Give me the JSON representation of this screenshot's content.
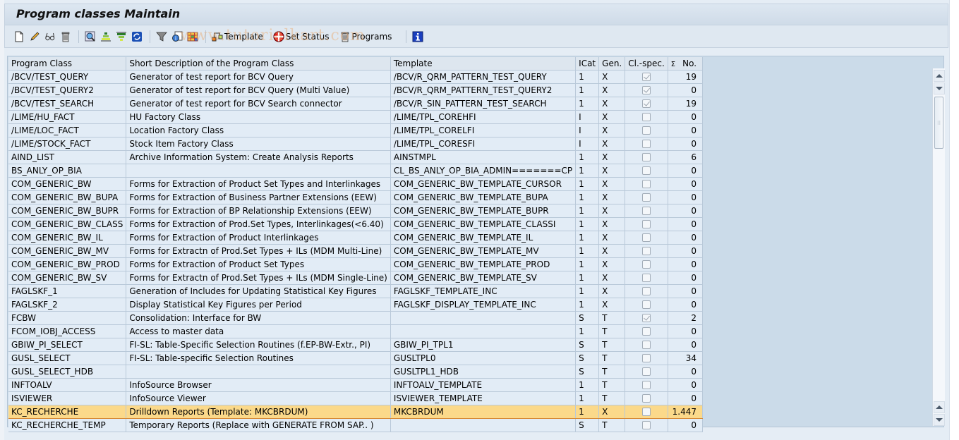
{
  "window": {
    "title": "Program classes Maintain"
  },
  "watermark": "www.tutorialkart.com",
  "toolbar": {
    "items": [
      {
        "icon": "new-document-icon"
      },
      {
        "icon": "pencil-edit-icon"
      },
      {
        "icon": "glasses-display-icon"
      },
      {
        "icon": "trash-delete-icon"
      },
      {
        "icon": "find-icon"
      },
      {
        "icon": "sort-ascending-icon"
      },
      {
        "icon": "sort-descending-icon"
      },
      {
        "icon": "refresh-icon"
      },
      {
        "icon": "filter-icon"
      },
      {
        "icon": "details-icon"
      },
      {
        "icon": "layout-grid-icon"
      }
    ],
    "template_label": "Template",
    "set_status_label": "Set Status",
    "programs_label": "Programs",
    "info_icon": "info-icon"
  },
  "table": {
    "columns": [
      "Program Class",
      "Short Description of the Program Class",
      "Template",
      "ICat",
      "Gen.",
      "Cl.-spec.",
      "No."
    ],
    "sum_symbol": "Σ",
    "selected_row": 25,
    "rows": [
      {
        "program_class": "/BCV/TEST_QUERY",
        "description": "Generator of test report for BCV Query",
        "template": "/BCV/R_QRM_PATTERN_TEST_QUERY",
        "icat": "1",
        "gen": "X",
        "cl_spec": true,
        "no": "19"
      },
      {
        "program_class": "/BCV/TEST_QUERY2",
        "description": "Generator of test report for BCV Query (Multi Value)",
        "template": "/BCV/R_QRM_PATTERN_TEST_QUERY2",
        "icat": "1",
        "gen": "X",
        "cl_spec": true,
        "no": "0"
      },
      {
        "program_class": "/BCV/TEST_SEARCH",
        "description": "Generator of test report for BCV Search connector",
        "template": "/BCV/R_SIN_PATTERN_TEST_SEARCH",
        "icat": "1",
        "gen": "X",
        "cl_spec": true,
        "no": "19"
      },
      {
        "program_class": "/LIME/HU_FACT",
        "description": "HU Factory Class",
        "template": "/LIME/TPL_COREHFI",
        "icat": "I",
        "gen": "X",
        "cl_spec": false,
        "no": "0"
      },
      {
        "program_class": "/LIME/LOC_FACT",
        "description": "Location Factory Class",
        "template": "/LIME/TPL_CORELFI",
        "icat": "I",
        "gen": "X",
        "cl_spec": false,
        "no": "0"
      },
      {
        "program_class": "/LIME/STOCK_FACT",
        "description": "Stock Item Factory Class",
        "template": "/LIME/TPL_CORESFI",
        "icat": "I",
        "gen": "X",
        "cl_spec": false,
        "no": "0"
      },
      {
        "program_class": "AIND_LIST",
        "description": "Archive Information System: Create Analysis Reports",
        "template": "AINSTMPL",
        "icat": "1",
        "gen": "X",
        "cl_spec": false,
        "no": "6"
      },
      {
        "program_class": "BS_ANLY_OP_BIA",
        "description": "",
        "template": "CL_BS_ANLY_OP_BIA_ADMIN=======CP",
        "icat": "1",
        "gen": "X",
        "cl_spec": false,
        "no": "0"
      },
      {
        "program_class": "COM_GENERIC_BW",
        "description": "Forms for Extraction of Product Set Types and Interlinkages",
        "template": "COM_GENERIC_BW_TEMPLATE_CURSOR",
        "icat": "1",
        "gen": "X",
        "cl_spec": false,
        "no": "0"
      },
      {
        "program_class": "COM_GENERIC_BW_BUPA",
        "description": "Forms for Extraction of Business Partner Extensions (EEW)",
        "template": "COM_GENERIC_BW_TEMPLATE_BUPA",
        "icat": "1",
        "gen": "X",
        "cl_spec": false,
        "no": "0"
      },
      {
        "program_class": "COM_GENERIC_BW_BUPR",
        "description": "Forms for Extraction of BP Relationship Extensions (EEW)",
        "template": "COM_GENERIC_BW_TEMPLATE_BUPR",
        "icat": "1",
        "gen": "X",
        "cl_spec": false,
        "no": "0"
      },
      {
        "program_class": "COM_GENERIC_BW_CLASS",
        "description": "Forms for Extraction of Prod.Set Types, Interlinkages(<6.40)",
        "template": "COM_GENERIC_BW_TEMPLATE_CLASSI",
        "icat": "1",
        "gen": "X",
        "cl_spec": false,
        "no": "0"
      },
      {
        "program_class": "COM_GENERIC_BW_IL",
        "description": "Forms for Extraction of Product Interlinkages",
        "template": "COM_GENERIC_BW_TEMPLATE_IL",
        "icat": "1",
        "gen": "X",
        "cl_spec": false,
        "no": "0"
      },
      {
        "program_class": "COM_GENERIC_BW_MV",
        "description": "Forms for Extractn of Prod.Set Types + ILs (MDM Multi-Line)",
        "template": "COM_GENERIC_BW_TEMPLATE_MV",
        "icat": "1",
        "gen": "X",
        "cl_spec": false,
        "no": "0"
      },
      {
        "program_class": "COM_GENERIC_BW_PROD",
        "description": "Forms for Extraction of Product Set Types",
        "template": "COM_GENERIC_BW_TEMPLATE_PROD",
        "icat": "1",
        "gen": "X",
        "cl_spec": false,
        "no": "0"
      },
      {
        "program_class": "COM_GENERIC_BW_SV",
        "description": "Forms for Extractn of Prod.Set Types + ILs (MDM Single-Line)",
        "template": "COM_GENERIC_BW_TEMPLATE_SV",
        "icat": "1",
        "gen": "X",
        "cl_spec": false,
        "no": "0"
      },
      {
        "program_class": "FAGLSKF_1",
        "description": "Generation of Includes for Updating Statistical Key Figures",
        "template": "FAGLSKF_TEMPLATE_INC",
        "icat": "1",
        "gen": "X",
        "cl_spec": false,
        "no": "0"
      },
      {
        "program_class": "FAGLSKF_2",
        "description": "Display Statistical Key Figures per Period",
        "template": "FAGLSKF_DISPLAY_TEMPLATE_INC",
        "icat": "1",
        "gen": "X",
        "cl_spec": false,
        "no": "0"
      },
      {
        "program_class": "FCBW",
        "description": "Consolidation: Interface for BW",
        "template": "",
        "icat": "S",
        "gen": "T",
        "cl_spec": true,
        "no": "2"
      },
      {
        "program_class": "FCOM_IOBJ_ACCESS",
        "description": "Access to master data",
        "template": "",
        "icat": "1",
        "gen": "T",
        "cl_spec": false,
        "no": "0"
      },
      {
        "program_class": "GBIW_PI_SELECT",
        "description": "FI-SL: Table-Specific Selection Routines (f.EP-BW-Extr., PI)",
        "template": "GBIW_PI_TPL1",
        "icat": "S",
        "gen": "T",
        "cl_spec": false,
        "no": "0"
      },
      {
        "program_class": "GUSL_SELECT",
        "description": "FI-SL: Table-specific Selection Routines",
        "template": "GUSLTPL0",
        "icat": "S",
        "gen": "T",
        "cl_spec": false,
        "no": "34"
      },
      {
        "program_class": "GUSL_SELECT_HDB",
        "description": "",
        "template": "GUSLTPL1_HDB",
        "icat": "S",
        "gen": "T",
        "cl_spec": false,
        "no": "0"
      },
      {
        "program_class": "INFTOALV",
        "description": "InfoSource Browser",
        "template": "INFTOALV_TEMPLATE",
        "icat": "1",
        "gen": "T",
        "cl_spec": false,
        "no": "0"
      },
      {
        "program_class": "ISVIEWER",
        "description": "InfoSource Viewer",
        "template": "ISVIEWER_TEMPLATE",
        "icat": "1",
        "gen": "T",
        "cl_spec": false,
        "no": "0"
      },
      {
        "program_class": "KC_RECHERCHE",
        "description": "Drilldown Reports  (Template: MKCBRDUM)",
        "template": "MKCBRDUM",
        "icat": "1",
        "gen": "X",
        "cl_spec": false,
        "no": "1.447"
      },
      {
        "program_class": "KC_RECHERCHE_TEMP",
        "description": "Temporary Reports (Replace with GENERATE FROM SAP.. )",
        "template": "",
        "icat": "S",
        "gen": "T",
        "cl_spec": false,
        "no": "0"
      }
    ]
  }
}
